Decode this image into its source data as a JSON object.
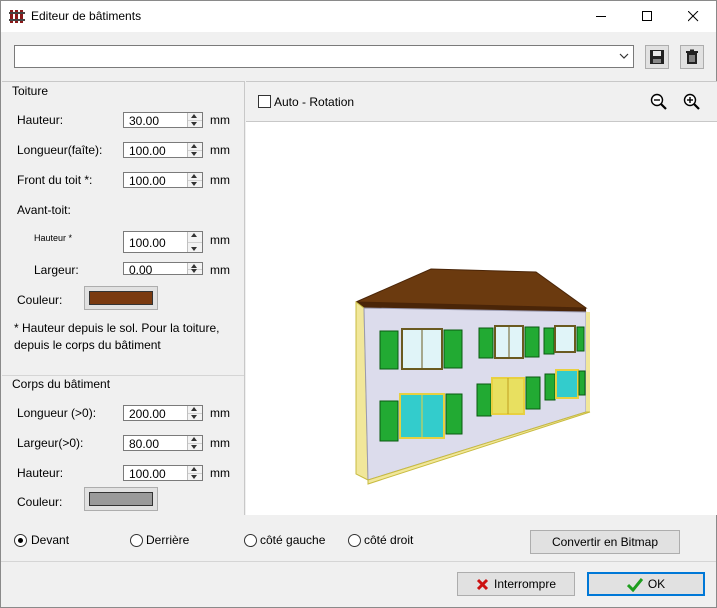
{
  "window": {
    "title": "Editeur de bâtiments"
  },
  "combo": {
    "value": ""
  },
  "roof": {
    "title": "Toiture",
    "height": {
      "label": "Hauteur:",
      "value": "30.00",
      "unit": "mm"
    },
    "length": {
      "label": "Longueur(faîte):",
      "value": "100.00",
      "unit": "mm"
    },
    "front": {
      "label": "Front du toit *:",
      "value": "100.00",
      "unit": "mm"
    },
    "eave_label": "Avant-toit:",
    "eave_height": {
      "label": "Hauteur *",
      "value": "100.00",
      "unit": "mm"
    },
    "eave_width": {
      "label": "Largeur:",
      "value": "0.00",
      "unit": "mm"
    },
    "color_label": "Couleur:",
    "color": "#7a3a10"
  },
  "note": "* Hauteur depuis le sol. Pour la toiture, depuis le corps du bâtiment",
  "body": {
    "title": "Corps du bâtiment",
    "length": {
      "label": "Longueur (>0):",
      "value": "200.00",
      "unit": "mm"
    },
    "width": {
      "label": "Largeur(>0):",
      "value": "80.00",
      "unit": "mm"
    },
    "height": {
      "label": "Hauteur:",
      "value": "100.00",
      "unit": "mm"
    },
    "color_label": "Couleur:",
    "color": "#9a9a9a"
  },
  "view": {
    "auto_rotation_label": "Auto - Rotation",
    "auto_rotation_checked": false
  },
  "views": {
    "front": "Devant",
    "back": "Derrière",
    "left": "côté gauche",
    "right": "côté droit",
    "selected": "front"
  },
  "buttons": {
    "convert": "Convertir en Bitmap",
    "cancel": "Interrompre",
    "ok": "OK"
  },
  "icons": {
    "save": "floppy-disk-icon",
    "delete": "trash-icon",
    "zoom_out": "zoom-out-icon",
    "zoom_in": "zoom-in-icon",
    "cancel": "red-x-icon",
    "ok": "green-check-icon"
  }
}
